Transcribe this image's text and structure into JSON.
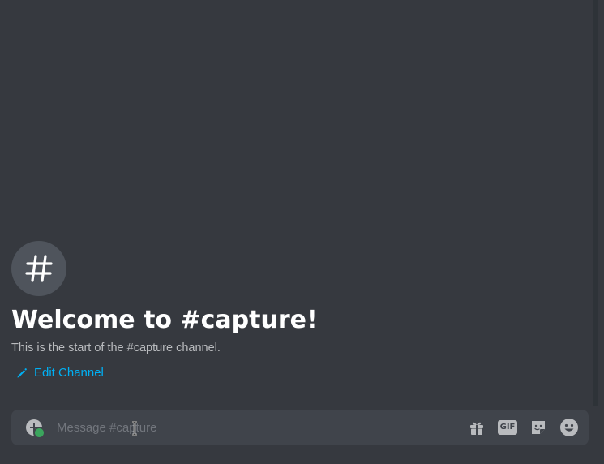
{
  "welcome": {
    "hash_symbol": "#",
    "title": "Welcome to #capture!",
    "subtitle": "This is the start of the #capture channel.",
    "edit_channel_label": "Edit Channel"
  },
  "composer": {
    "placeholder": "Message #capture",
    "value": "",
    "gif_label": "GIF"
  },
  "icons": {
    "channel": "hashtag-icon",
    "edit": "pencil-icon",
    "attach": "plus-circle-icon",
    "gift": "gift-icon",
    "gif": "gif-icon",
    "sticker": "sticker-icon",
    "emoji": "emoji-icon"
  },
  "colors": {
    "background": "#36393f",
    "input_background": "#40444b",
    "link": "#00b0f4",
    "title": "#ffffff",
    "muted": "#b9bbbe",
    "online_badge": "#3ba55d"
  }
}
